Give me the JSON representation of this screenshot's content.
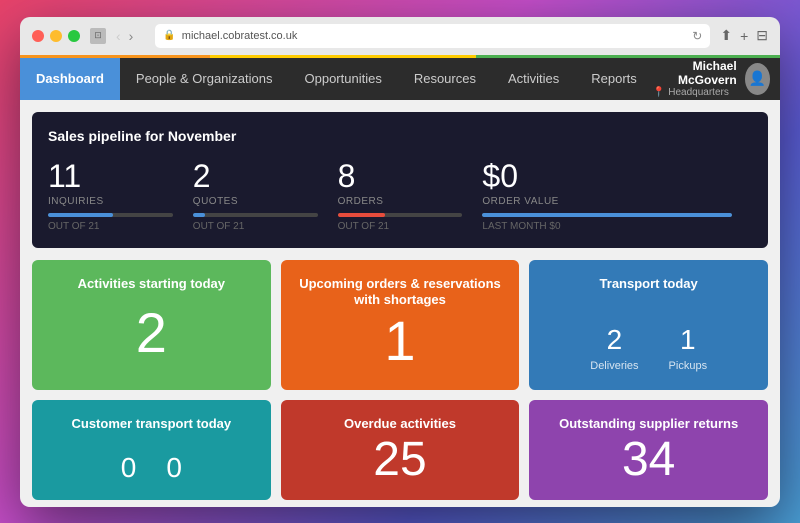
{
  "window": {
    "url": "michael.cobratest.co.uk",
    "title": "Dashboard"
  },
  "titlebar": {
    "back_disabled": false,
    "forward_disabled": false
  },
  "navbar": {
    "items": [
      {
        "id": "dashboard",
        "label": "Dashboard",
        "active": true
      },
      {
        "id": "people-orgs",
        "label": "People & Organizations",
        "active": false
      },
      {
        "id": "opportunities",
        "label": "Opportunities",
        "active": false
      },
      {
        "id": "resources",
        "label": "Resources",
        "active": false
      },
      {
        "id": "activities",
        "label": "Activities",
        "active": false
      },
      {
        "id": "reports",
        "label": "Reports",
        "active": false
      }
    ],
    "user": {
      "name": "Michael McGovern",
      "location": "Headquarters"
    }
  },
  "pipeline": {
    "title": "Sales pipeline for November",
    "stats": [
      {
        "id": "inquiries",
        "number": "11",
        "label": "INQUIRIES",
        "sub": "OUT OF 21",
        "progress": 52,
        "color": "blue"
      },
      {
        "id": "quotes",
        "number": "2",
        "label": "QUOTES",
        "sub": "OUT OF 21",
        "progress": 10,
        "color": "blue"
      },
      {
        "id": "orders",
        "number": "8",
        "label": "ORDERS",
        "sub": "OUT OF 21",
        "progress": 38,
        "color": "red"
      },
      {
        "id": "order-value",
        "number": "$0",
        "label": "ORDER VALUE",
        "sub": "LAST MONTH $0",
        "progress": 100,
        "color": "blue"
      }
    ]
  },
  "dashboard_cards": [
    {
      "id": "activities-today",
      "title": "Activities starting today",
      "number": "2",
      "color": "green",
      "type": "single"
    },
    {
      "id": "upcoming-orders",
      "title": "Upcoming orders & reservations with shortages",
      "number": "1",
      "color": "orange",
      "type": "single"
    },
    {
      "id": "transport-today",
      "title": "Transport today",
      "color": "blue",
      "type": "dual",
      "sub_items": [
        {
          "label": "Deliveries",
          "number": "2"
        },
        {
          "label": "Pickups",
          "number": "1"
        }
      ]
    }
  ],
  "bottom_cards": [
    {
      "id": "customer-transport",
      "title": "Customer transport today",
      "color": "teal",
      "type": "dual",
      "sub_items": [
        {
          "label": "",
          "number": "0"
        },
        {
          "label": "",
          "number": "0"
        }
      ]
    },
    {
      "id": "overdue-activities",
      "title": "Overdue activities",
      "number": "25",
      "color": "red",
      "type": "single"
    },
    {
      "id": "outstanding-supplier",
      "title": "Outstanding supplier returns",
      "number": "34",
      "color": "purple",
      "type": "single"
    }
  ]
}
